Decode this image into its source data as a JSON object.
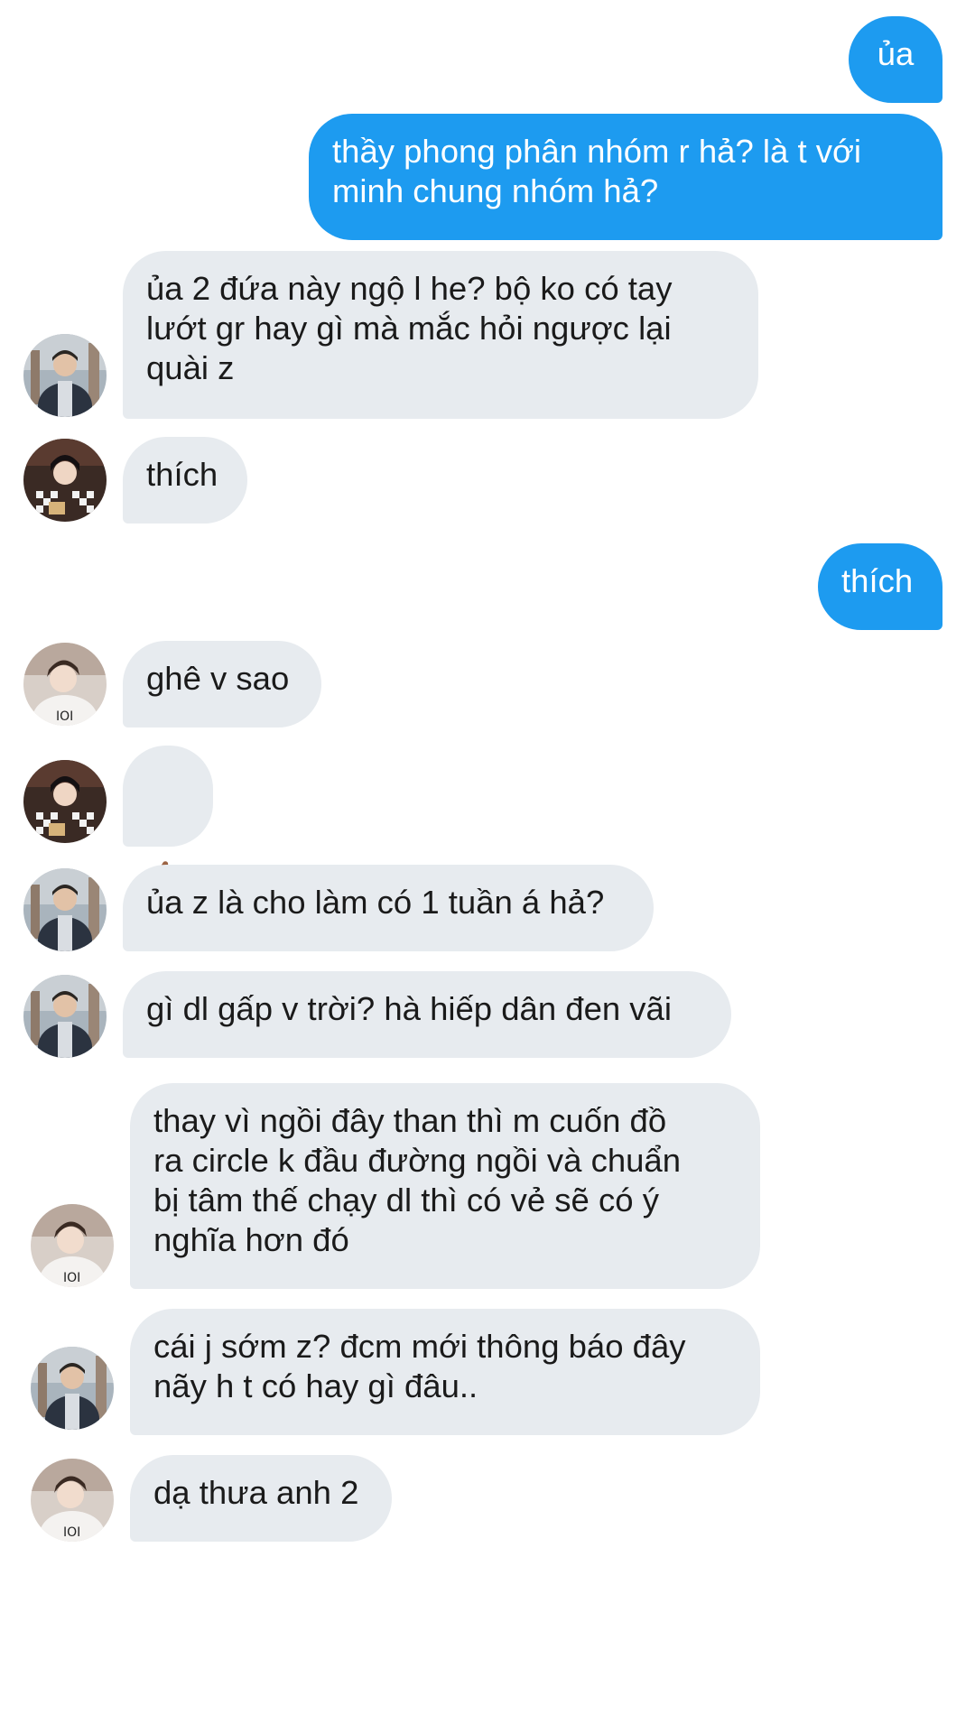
{
  "conversation": {
    "messages": [
      {
        "side": "out",
        "text": "ủa"
      },
      {
        "side": "out",
        "text": "thầy phong phân nhóm r hả? là t với\nminh chung nhóm hả?"
      },
      {
        "side": "in",
        "avatar": "avatar-a",
        "text": "ủa 2 đứa này ngộ l he? bộ ko có tay\nlướt gr hay gì mà mắc hỏi ngược lại\nquài z"
      },
      {
        "side": "in",
        "avatar": "avatar-b",
        "text": "thích"
      },
      {
        "side": "out",
        "text": "thích"
      },
      {
        "side": "in",
        "avatar": "avatar-c",
        "text": "ghê v sao"
      },
      {
        "side": "in",
        "avatar": "avatar-b",
        "emoji": "thumbs-up-icon"
      },
      {
        "side": "in",
        "avatar": "avatar-a",
        "text": "ủa z là cho làm có 1 tuần á hả?"
      },
      {
        "side": "in",
        "avatar": "avatar-a",
        "text": "gì dl gấp v trời? hà hiếp dân đen vãi"
      },
      {
        "side": "in",
        "avatar": "avatar-c",
        "text": "thay vì ngồi đây than thì m cuốn đồ\nra circle k đầu đường ngồi và chuẩn\nbị tâm thế chạy dl thì có vẻ sẽ có ý\nnghĩa hơn đó"
      },
      {
        "side": "in",
        "avatar": "avatar-a",
        "text": "cái j sớm z? đcm mới thông báo đây\nnãy h t có hay gì đâu.."
      },
      {
        "side": "in",
        "avatar": "avatar-c",
        "text": "dạ thưa anh 2"
      }
    ]
  },
  "colors": {
    "outgoing_bubble": "#1d9bf0",
    "incoming_bubble": "#e7ebef",
    "background": "#ffffff"
  }
}
